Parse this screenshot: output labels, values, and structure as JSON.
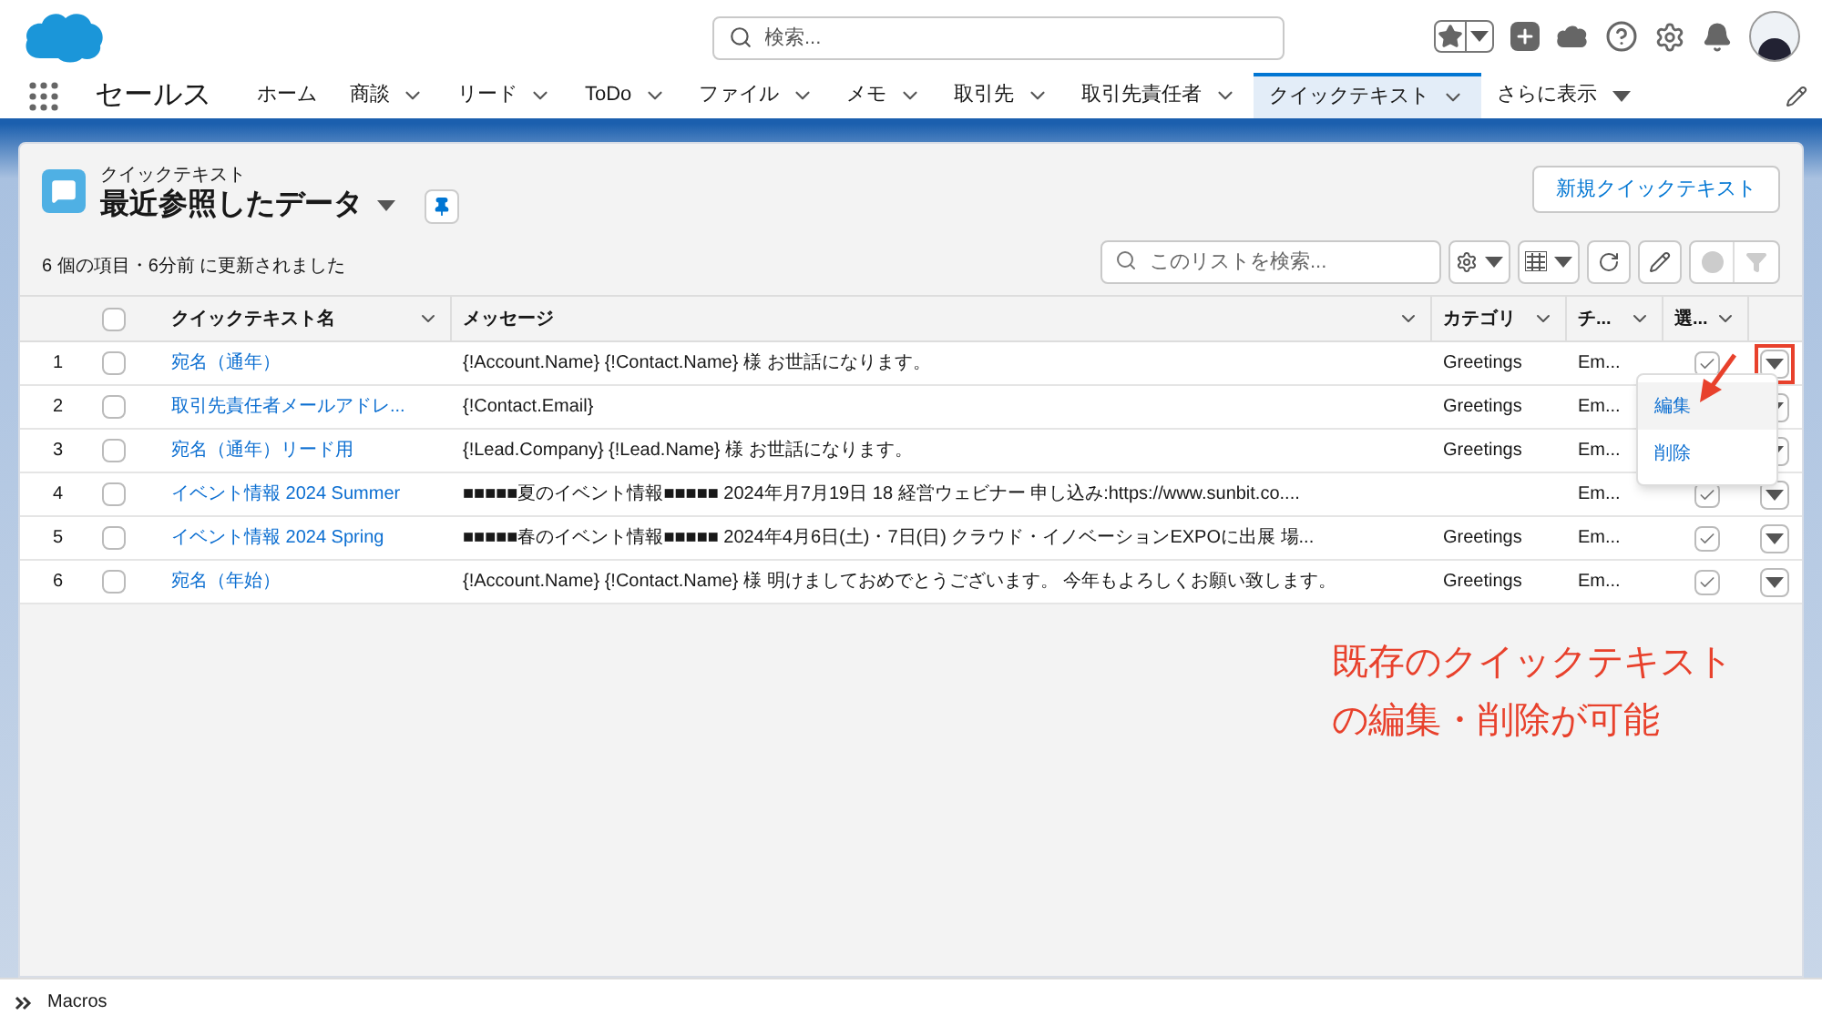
{
  "header": {
    "search_placeholder": "検索..."
  },
  "nav": {
    "app_name": "セールス",
    "items": [
      {
        "label": "ホーム",
        "dropdown": false,
        "selected": false
      },
      {
        "label": "商談",
        "dropdown": true,
        "selected": false
      },
      {
        "label": "リード",
        "dropdown": true,
        "selected": false
      },
      {
        "label": "ToDo",
        "dropdown": true,
        "selected": false
      },
      {
        "label": "ファイル",
        "dropdown": true,
        "selected": false
      },
      {
        "label": "メモ",
        "dropdown": true,
        "selected": false
      },
      {
        "label": "取引先",
        "dropdown": true,
        "selected": false
      },
      {
        "label": "取引先責任者",
        "dropdown": true,
        "selected": false
      },
      {
        "label": "クイックテキスト",
        "dropdown": true,
        "selected": true
      }
    ],
    "more": "さらに表示"
  },
  "list_view": {
    "object_label": "クイックテキスト",
    "title": "最近参照したデータ",
    "new_button": "新規クイックテキスト",
    "status": "6 個の項目・6分前 に更新されました",
    "search_placeholder": "このリストを検索...",
    "columns": [
      "クイックテキスト名",
      "メッセージ",
      "カテゴリ",
      "チ...",
      "選..."
    ],
    "select_all_checked": false,
    "rows": [
      {
        "number": "1",
        "name": "宛名（通年）",
        "message": "{!Account.Name} {!Contact.Name} 様 お世話になります。",
        "category": "Greetings",
        "channel": "Em...",
        "checked": true,
        "selected": false
      },
      {
        "number": "2",
        "name": "取引先責任者メールアドレ...",
        "message": "{!Contact.Email}",
        "category": "Greetings",
        "channel": "Em...",
        "selected": false
      },
      {
        "number": "3",
        "name": "宛名（通年）リード用",
        "message": "{!Lead.Company} {!Lead.Name} 様 お世話になります。",
        "category": "Greetings",
        "channel": "Em...",
        "selected": false
      },
      {
        "number": "4",
        "name": "イベント情報 2024 Summer",
        "message": "■■■■■夏のイベント情報■■■■■ 2024年月7月19日 18 経営ウェビナー 申し込み:https://www.sunbit.co....",
        "category": "",
        "channel": "Em...",
        "checked": true,
        "selected": false
      },
      {
        "number": "5",
        "name": "イベント情報 2024 Spring",
        "message": "■■■■■春のイベント情報■■■■■ 2024年4月6日(土)・7日(日) クラウド・イノベーションEXPOに出展 場...",
        "category": "Greetings",
        "channel": "Em...",
        "checked": true,
        "selected": false
      },
      {
        "number": "6",
        "name": "宛名（年始）",
        "message": "{!Account.Name} {!Contact.Name} 様 明けましておめでとうございます。 今年もよろしくお願い致します。",
        "category": "Greetings",
        "channel": "Em...",
        "checked": true,
        "selected": false
      }
    ],
    "row_menu": {
      "items": [
        {
          "label": "編集",
          "selected": true
        },
        {
          "label": "削除",
          "selected": false
        }
      ]
    }
  },
  "annotation": {
    "lines": [
      "既存のクイックテキスト",
      "の編集・削除が可能"
    ]
  },
  "utility_bar": {
    "label": "Macros"
  }
}
